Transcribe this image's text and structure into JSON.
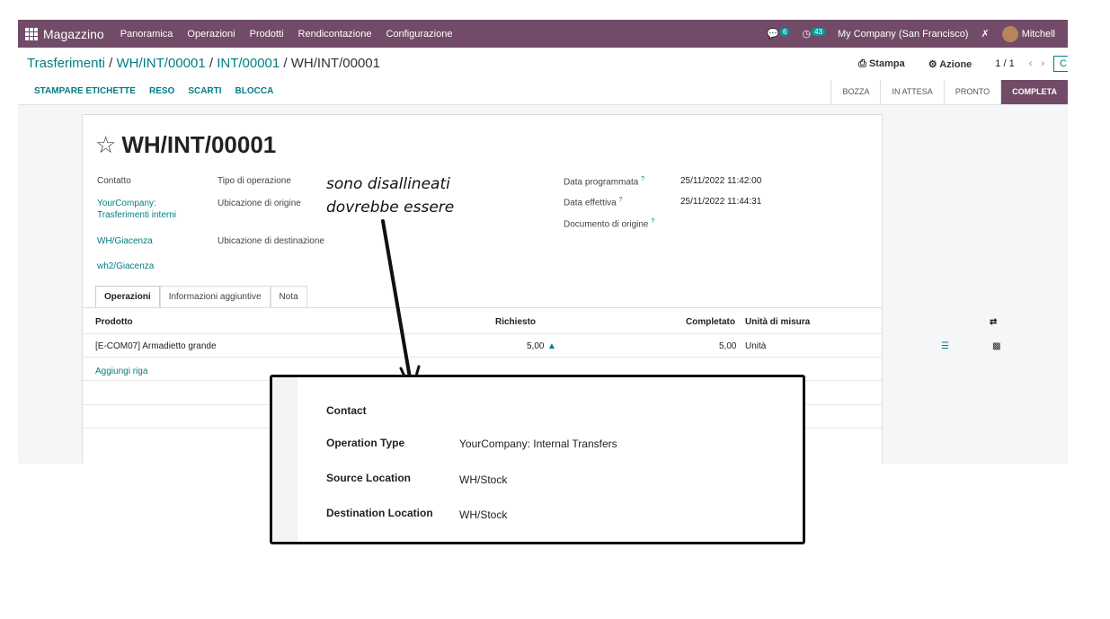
{
  "navbar": {
    "brand": "Magazzino",
    "menus": [
      "Panoramica",
      "Operazioni",
      "Prodotti",
      "Rendicontazione",
      "Configurazione"
    ],
    "chat_count": "6",
    "activity_count": "43",
    "company": "My Company (San Francisco)",
    "user": "Mitchell"
  },
  "breadcrumb": {
    "items": [
      "Trasferimenti",
      "WH/INT/00001",
      "INT/00001"
    ],
    "current": "WH/INT/00001"
  },
  "control": {
    "print": "Stampa",
    "action": "Azione",
    "pager": "1 / 1",
    "create": "C"
  },
  "status_buttons": [
    "STAMPARE ETICHETTE",
    "RESO",
    "SCARTI",
    "BLOCCA"
  ],
  "stages": [
    "BOZZA",
    "IN ATTESA",
    "PRONTO",
    "COMPLETA"
  ],
  "form": {
    "title": "WH/INT/00001",
    "contact_label": "Contatto",
    "contact_value_1": "YourCompany:",
    "contact_value_2": "Trasferimenti interni",
    "operation_type_label": "Tipo di operazione",
    "source_label": "Ubicazione di origine",
    "source_value": "WH/Giacenza",
    "dest_label": "Ubicazione di destinazione",
    "dest_value": "wh2/Giacenza",
    "scheduled_label": "Data programmata",
    "scheduled_value": "25/11/2022 11:42:00",
    "effective_label": "Data effettiva",
    "effective_value": "25/11/2022 11:44:31",
    "origin_label": "Documento di origine"
  },
  "tabs": [
    "Operazioni",
    "Informazioni aggiuntive",
    "Nota"
  ],
  "table": {
    "columns": [
      "Prodotto",
      "Richiesto",
      "Completato",
      "Unità di misura"
    ],
    "rows": [
      {
        "product": "[E-COM07] Armadietto grande",
        "requested": "5,00",
        "done": "5,00",
        "uom": "Unità"
      }
    ],
    "add_line": "Aggiungi riga"
  },
  "annotation": {
    "line1": "sono disallineati",
    "line2": "dovrebbe essere"
  },
  "popup": {
    "contact_label": "Contact",
    "operation_type_label": "Operation Type",
    "operation_type_value": "YourCompany: Internal Transfers",
    "source_label": "Source Location",
    "source_value": "WH/Stock",
    "dest_label": "Destination Location",
    "dest_value": "WH/Stock"
  }
}
